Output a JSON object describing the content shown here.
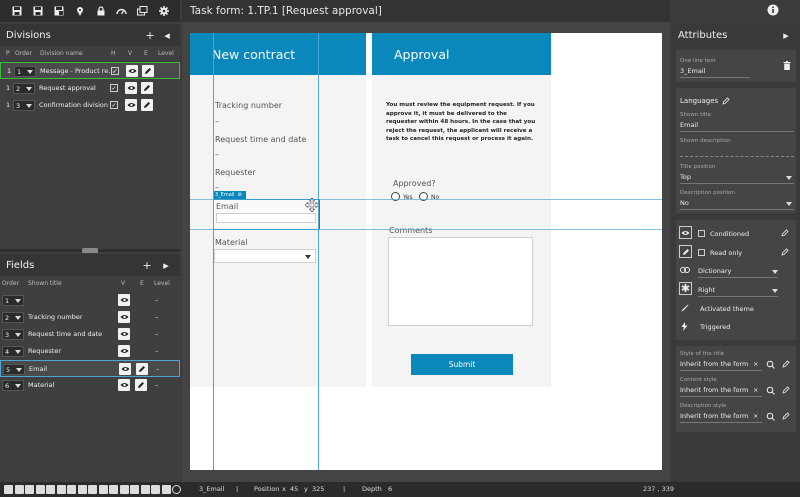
{
  "toolbar": {
    "icons": [
      "save-icon",
      "save-all-icon",
      "save-as-icon",
      "pin-icon",
      "lock-icon",
      "gauge-icon",
      "windows-icon",
      "gear-icon"
    ]
  },
  "title": "Task form: 1.TP.1 [Request approval]",
  "divisions": {
    "title": "Divisions",
    "columns": [
      "P",
      "Order",
      "Division name",
      "H",
      "V",
      "E",
      "Level"
    ],
    "rows": [
      {
        "p": "1",
        "order": "1",
        "name": "Message - Product re...",
        "selected": true
      },
      {
        "p": "1",
        "order": "2",
        "name": "Request approval"
      },
      {
        "p": "1",
        "order": "3",
        "name": "Confirmation division"
      }
    ]
  },
  "fields": {
    "title": "Fields",
    "columns": [
      "Order",
      "Shown title",
      "V",
      "E",
      "Level"
    ],
    "rows": [
      {
        "order": "1",
        "title": "",
        "edit": false
      },
      {
        "order": "2",
        "title": "Tracking number",
        "edit": false
      },
      {
        "order": "3",
        "title": "Request time and date",
        "edit": false
      },
      {
        "order": "4",
        "title": "Requester",
        "edit": false
      },
      {
        "order": "5",
        "title": "Email",
        "edit": true,
        "selected": true
      },
      {
        "order": "6",
        "title": "Material",
        "edit": true
      }
    ],
    "level_placeholder": "–"
  },
  "form": {
    "left_header": "New contract",
    "right_header": "Approval",
    "fields": [
      {
        "label": "Tracking number",
        "value": "–"
      },
      {
        "label": "Request time and date",
        "value": "–"
      },
      {
        "label": "Requester",
        "value": "–"
      }
    ],
    "email_tag": "3_Email",
    "email_label": "Email",
    "material_label": "Material",
    "approval_text": "You must review the equipment request. If you approve it, it must be delivered to the requester within 48 hours. In the case that you reject the request, the applicant will receive a task to cancel this request or process it again.",
    "approved_label": "Approved?",
    "yes": "Yes",
    "no": "No",
    "comments_label": "Comments",
    "submit_label": "Submit"
  },
  "attributes": {
    "title": "Attributes",
    "one_line_label": "One line text",
    "one_line_value": "3_Email",
    "languages_label": "Languages",
    "shown_title_label": "Shown title",
    "shown_title_value": "Email",
    "shown_desc_label": "Shown description",
    "title_pos_label": "Title position",
    "title_pos_value": "Top",
    "desc_pos_label": "Description position",
    "desc_pos_value": "No",
    "conditioned": "Conditioned",
    "read_only": "Read only",
    "dictionary": "Dictionary",
    "align": "Right",
    "activated_theme": "Activated theme",
    "triggered": "Triggered",
    "style_title_label": "Style of the title",
    "style_title_value": "Inherit from the form",
    "content_style_label": "Content style",
    "content_style_value": "Inherit from the form",
    "desc_style_label": "Description style",
    "desc_style_value": "Inherit from the form",
    "clear": "×"
  },
  "status": {
    "name": "3_Email",
    "sep": "|",
    "position_label": "Position",
    "x_label": "x",
    "x": "45",
    "y_label": "y",
    "y": "325",
    "depth_label": "Depth",
    "depth": "6",
    "coords": "237 , 339"
  },
  "colors": {
    "accent": "#0a87bb",
    "guide": "#4ea6d6",
    "selected_green": "#3dbb3d"
  }
}
